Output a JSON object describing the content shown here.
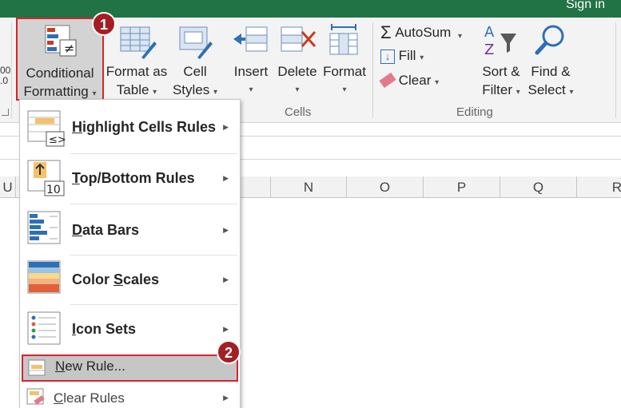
{
  "titlebar": {
    "sign_in": "Sign in"
  },
  "ribbon": {
    "conditional_formatting": {
      "line1": "Conditional",
      "line2": "Formatting"
    },
    "format_as_table": {
      "line1": "Format as",
      "line2": "Table"
    },
    "cell_styles": {
      "line1": "Cell",
      "line2": "Styles"
    },
    "insert": "Insert",
    "delete": "Delete",
    "format": "Format",
    "cells_group": "Cells",
    "autosum": "AutoSum",
    "fill": "Fill",
    "clear": "Clear",
    "sort_filter": {
      "line1": "Sort &",
      "line2": "Filter"
    },
    "find_select": {
      "line1": "Find &",
      "line2": "Select"
    },
    "editing_group": "Editing",
    "number_fragment": {
      "line1": "00",
      "line2": ".0"
    }
  },
  "badges": {
    "first": "1",
    "second": "2"
  },
  "columns": [
    "U",
    "N",
    "O",
    "P",
    "Q",
    "R"
  ],
  "menu": {
    "items": [
      {
        "accel": "H",
        "rest": "ighlight Cells Rules"
      },
      {
        "accel": "T",
        "rest": "op/Bottom Rules"
      },
      {
        "accel": "D",
        "rest": "ata Bars"
      },
      {
        "pre": "Color ",
        "accel": "S",
        "rest": "cales"
      },
      {
        "accel": "I",
        "rest": "con Sets"
      }
    ],
    "new_rule": {
      "accel": "N",
      "rest": "ew Rule..."
    },
    "clear_rules": {
      "accel": "C",
      "rest": "lear Rules"
    }
  },
  "colors": {
    "accent": "#217346",
    "highlight": "#d8232a",
    "badge": "#a31f24"
  }
}
